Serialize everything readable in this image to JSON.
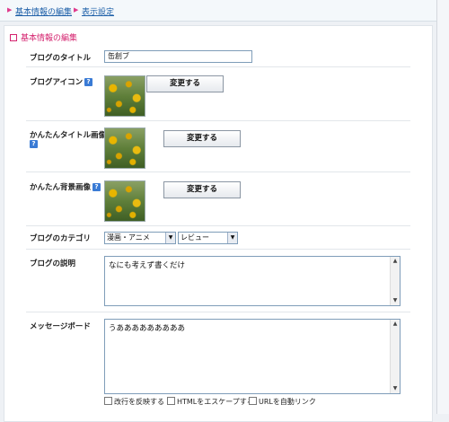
{
  "nav": {
    "link1": "基本情報の編集",
    "link2": "表示設定"
  },
  "section": {
    "title": "基本情報の編集"
  },
  "fields": {
    "blog_title": {
      "label": "ブログのタイトル",
      "value": "缶創ブ"
    },
    "blog_icon": {
      "label": "ブログアイコン",
      "help_glyph": "?",
      "button": "変更する"
    },
    "title_image": {
      "label": "かんたんタイトル画像",
      "help_glyph": "?",
      "button": "変更する"
    },
    "bg_image": {
      "label": "かんたん背景画像",
      "help_glyph": "?",
      "button": "変更する"
    },
    "category": {
      "label": "ブログのカテゴリ",
      "select1": "漫画・アニメ",
      "select2": "レビュー"
    },
    "description": {
      "label": "ブログの説明",
      "value": "なにも考えず書くだけ"
    },
    "message_board": {
      "label": "メッセージボード",
      "value": "うあああああああああ",
      "options": [
        "改行を反映する",
        "HTMLをエスケープする",
        "URLを自動リンク"
      ]
    }
  },
  "icons": {
    "scroll_up": "▲",
    "scroll_down": "▼",
    "dropdown": "▼",
    "bullet": "▶"
  }
}
